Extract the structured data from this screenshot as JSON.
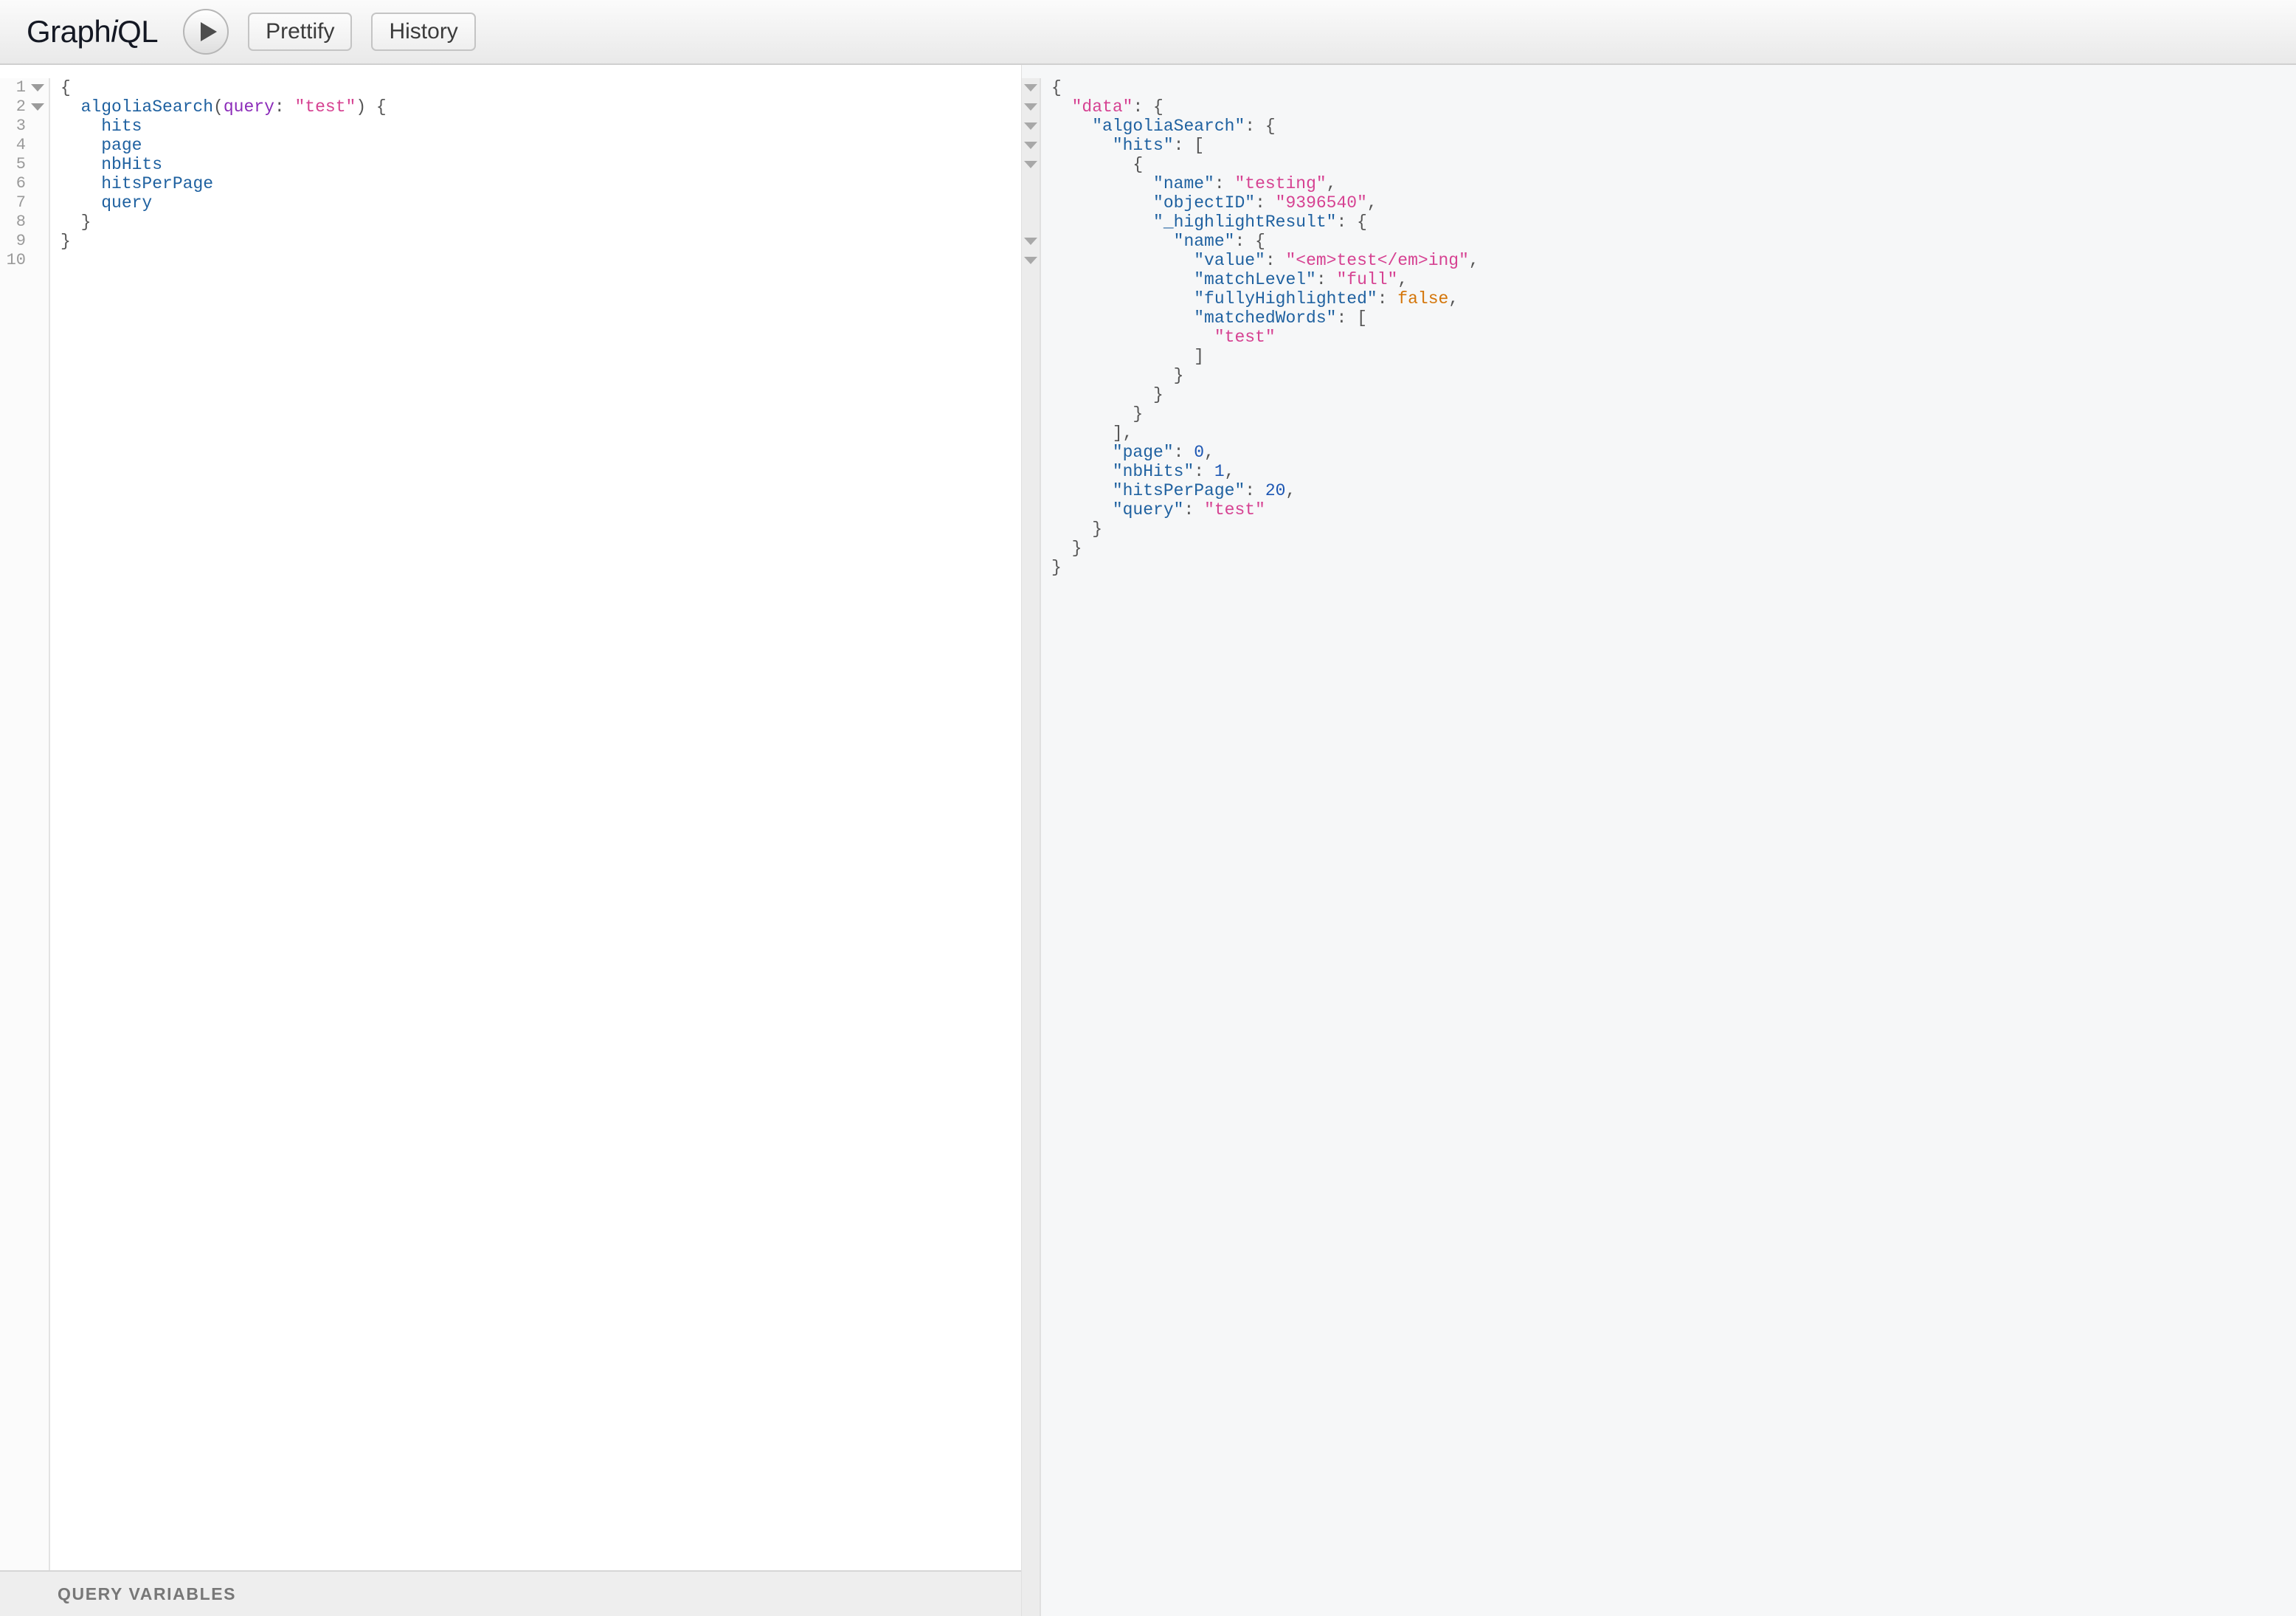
{
  "app": {
    "logo_prefix": "Graph",
    "logo_italic": "i",
    "logo_suffix": "QL"
  },
  "toolbar": {
    "execute_label": "▶",
    "prettify_label": "Prettify",
    "history_label": "History"
  },
  "query_editor": {
    "line_numbers": [
      "1",
      "2",
      "3",
      "4",
      "5",
      "6",
      "7",
      "8",
      "9",
      "10"
    ],
    "folds": [
      true,
      true,
      false,
      false,
      false,
      false,
      false,
      false,
      false,
      false
    ],
    "lines": [
      [
        {
          "t": "{",
          "c": "punc"
        }
      ],
      [
        {
          "t": "  ",
          "c": "punc"
        },
        {
          "t": "algoliaSearch",
          "c": "field"
        },
        {
          "t": "(",
          "c": "punc"
        },
        {
          "t": "query",
          "c": "arg"
        },
        {
          "t": ": ",
          "c": "punc"
        },
        {
          "t": "\"test\"",
          "c": "str"
        },
        {
          "t": ") {",
          "c": "punc"
        }
      ],
      [
        {
          "t": "    ",
          "c": "punc"
        },
        {
          "t": "hits",
          "c": "field"
        }
      ],
      [
        {
          "t": "    ",
          "c": "punc"
        },
        {
          "t": "page",
          "c": "field"
        }
      ],
      [
        {
          "t": "    ",
          "c": "punc"
        },
        {
          "t": "nbHits",
          "c": "field"
        }
      ],
      [
        {
          "t": "    ",
          "c": "punc"
        },
        {
          "t": "hitsPerPage",
          "c": "field"
        }
      ],
      [
        {
          "t": "    ",
          "c": "punc"
        },
        {
          "t": "query",
          "c": "field"
        }
      ],
      [
        {
          "t": "  }",
          "c": "punc"
        }
      ],
      [
        {
          "t": "}",
          "c": "punc"
        }
      ],
      []
    ]
  },
  "query_variables": {
    "title": "QUERY VARIABLES"
  },
  "result_viewer": {
    "fold_rows": [
      1,
      2,
      3,
      4,
      5,
      9,
      10
    ],
    "lines": [
      [
        {
          "t": "{",
          "c": "punc"
        }
      ],
      [
        {
          "t": "  ",
          "c": "punc"
        },
        {
          "t": "\"data\"",
          "c": "dkey"
        },
        {
          "t": ": {",
          "c": "punc"
        }
      ],
      [
        {
          "t": "    ",
          "c": "punc"
        },
        {
          "t": "\"algoliaSearch\"",
          "c": "key"
        },
        {
          "t": ": {",
          "c": "punc"
        }
      ],
      [
        {
          "t": "      ",
          "c": "punc"
        },
        {
          "t": "\"hits\"",
          "c": "key"
        },
        {
          "t": ": [",
          "c": "punc"
        }
      ],
      [
        {
          "t": "        {",
          "c": "punc"
        }
      ],
      [
        {
          "t": "          ",
          "c": "punc"
        },
        {
          "t": "\"name\"",
          "c": "key"
        },
        {
          "t": ": ",
          "c": "punc"
        },
        {
          "t": "\"testing\"",
          "c": "str"
        },
        {
          "t": ",",
          "c": "punc"
        }
      ],
      [
        {
          "t": "          ",
          "c": "punc"
        },
        {
          "t": "\"objectID\"",
          "c": "key"
        },
        {
          "t": ": ",
          "c": "punc"
        },
        {
          "t": "\"9396540\"",
          "c": "str"
        },
        {
          "t": ",",
          "c": "punc"
        }
      ],
      [
        {
          "t": "          ",
          "c": "punc"
        },
        {
          "t": "\"_highlightResult\"",
          "c": "key"
        },
        {
          "t": ": {",
          "c": "punc"
        }
      ],
      [
        {
          "t": "            ",
          "c": "punc"
        },
        {
          "t": "\"name\"",
          "c": "key"
        },
        {
          "t": ": {",
          "c": "punc"
        }
      ],
      [
        {
          "t": "              ",
          "c": "punc"
        },
        {
          "t": "\"value\"",
          "c": "key"
        },
        {
          "t": ": ",
          "c": "punc"
        },
        {
          "t": "\"<em>test</em>ing\"",
          "c": "str"
        },
        {
          "t": ",",
          "c": "punc"
        }
      ],
      [
        {
          "t": "              ",
          "c": "punc"
        },
        {
          "t": "\"matchLevel\"",
          "c": "key"
        },
        {
          "t": ": ",
          "c": "punc"
        },
        {
          "t": "\"full\"",
          "c": "str"
        },
        {
          "t": ",",
          "c": "punc"
        }
      ],
      [
        {
          "t": "              ",
          "c": "punc"
        },
        {
          "t": "\"fullyHighlighted\"",
          "c": "key"
        },
        {
          "t": ": ",
          "c": "punc"
        },
        {
          "t": "false",
          "c": "bool"
        },
        {
          "t": ",",
          "c": "punc"
        }
      ],
      [
        {
          "t": "              ",
          "c": "punc"
        },
        {
          "t": "\"matchedWords\"",
          "c": "key"
        },
        {
          "t": ": [",
          "c": "punc"
        }
      ],
      [
        {
          "t": "                ",
          "c": "punc"
        },
        {
          "t": "\"test\"",
          "c": "str"
        }
      ],
      [
        {
          "t": "              ]",
          "c": "punc"
        }
      ],
      [
        {
          "t": "            }",
          "c": "punc"
        }
      ],
      [
        {
          "t": "          }",
          "c": "punc"
        }
      ],
      [
        {
          "t": "        }",
          "c": "punc"
        }
      ],
      [
        {
          "t": "      ],",
          "c": "punc"
        }
      ],
      [
        {
          "t": "      ",
          "c": "punc"
        },
        {
          "t": "\"page\"",
          "c": "key"
        },
        {
          "t": ": ",
          "c": "punc"
        },
        {
          "t": "0",
          "c": "num"
        },
        {
          "t": ",",
          "c": "punc"
        }
      ],
      [
        {
          "t": "      ",
          "c": "punc"
        },
        {
          "t": "\"nbHits\"",
          "c": "key"
        },
        {
          "t": ": ",
          "c": "punc"
        },
        {
          "t": "1",
          "c": "num"
        },
        {
          "t": ",",
          "c": "punc"
        }
      ],
      [
        {
          "t": "      ",
          "c": "punc"
        },
        {
          "t": "\"hitsPerPage\"",
          "c": "key"
        },
        {
          "t": ": ",
          "c": "punc"
        },
        {
          "t": "20",
          "c": "num"
        },
        {
          "t": ",",
          "c": "punc"
        }
      ],
      [
        {
          "t": "      ",
          "c": "punc"
        },
        {
          "t": "\"query\"",
          "c": "key"
        },
        {
          "t": ": ",
          "c": "punc"
        },
        {
          "t": "\"test\"",
          "c": "str"
        }
      ],
      [
        {
          "t": "    }",
          "c": "punc"
        }
      ],
      [
        {
          "t": "  }",
          "c": "punc"
        }
      ],
      [
        {
          "t": "}",
          "c": "punc"
        }
      ]
    ]
  },
  "colors": {
    "field": "#1f61a0",
    "argument": "#8b2bb9",
    "string": "#d64292",
    "number": "#1c56b3",
    "boolean": "#d47509",
    "punctuation": "#555555",
    "data_key": "#d64292",
    "result_background": "#f6f7f8",
    "toolbar_background": "#efefef"
  }
}
